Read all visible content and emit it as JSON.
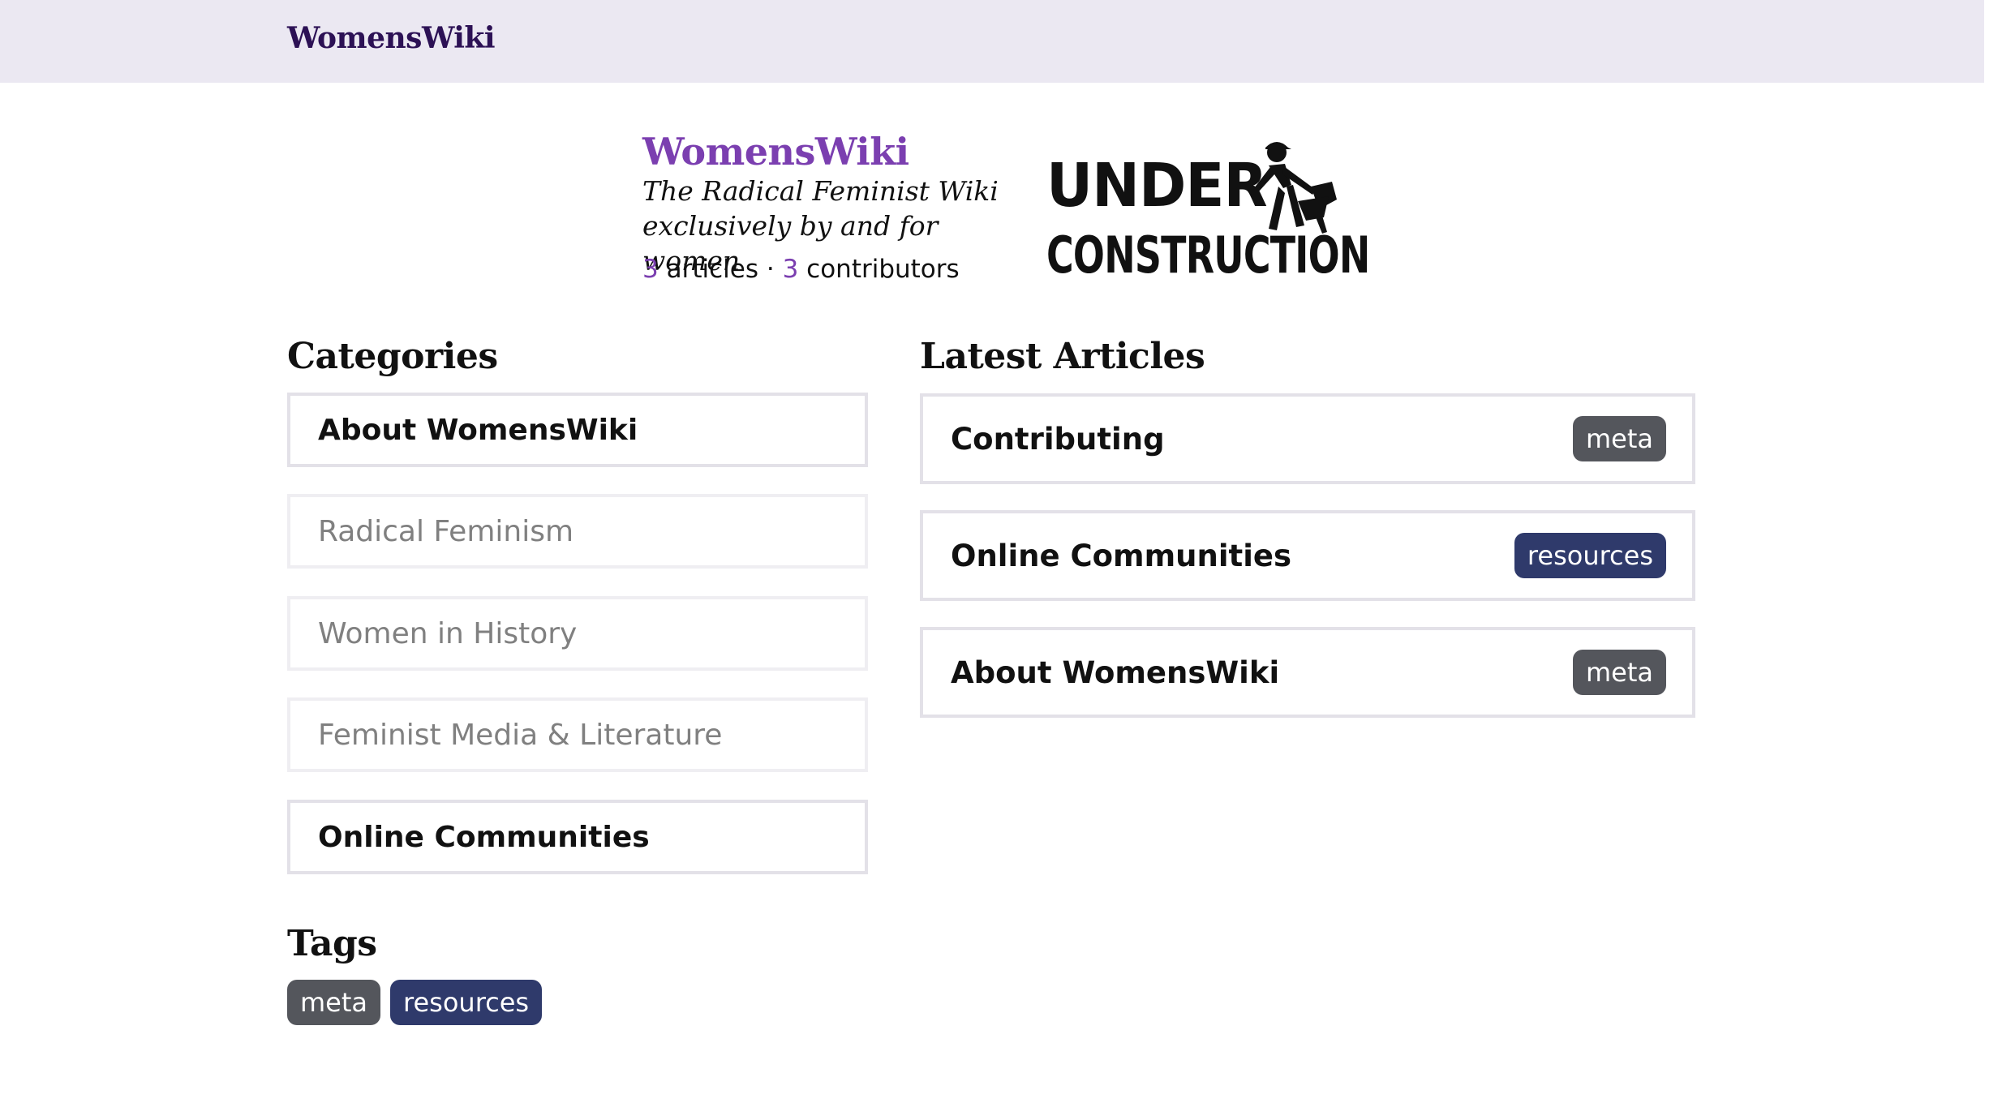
{
  "header": {
    "brand": "WomensWiki"
  },
  "hero": {
    "title": "WomensWiki",
    "tagline_line1": "The Radical Feminist Wiki",
    "tagline_line2": "exclusively by and for women",
    "article_count": "3",
    "articles_label": "articles",
    "separator": "·",
    "contributor_count": "3",
    "contributors_label": "contributors",
    "construction_line1": "UNDER",
    "construction_line2": "CONSTRUCTION",
    "construction_icon": "worker-with-shovel-icon"
  },
  "categories": {
    "heading": "Categories",
    "items": [
      {
        "label": "About WomensWiki",
        "state": "active"
      },
      {
        "label": "Radical Feminism",
        "state": "dim"
      },
      {
        "label": "Women in History",
        "state": "dim"
      },
      {
        "label": "Feminist Media & Literature",
        "state": "dim"
      },
      {
        "label": "Online Communities",
        "state": "active"
      }
    ]
  },
  "latest": {
    "heading": "Latest Articles",
    "items": [
      {
        "title": "Contributing",
        "tag": "meta"
      },
      {
        "title": "Online Communities",
        "tag": "resources"
      },
      {
        "title": "About WomensWiki",
        "tag": "meta"
      }
    ]
  },
  "tags": {
    "heading": "Tags",
    "items": [
      "meta",
      "resources"
    ]
  },
  "colors": {
    "accent": "#7b3fb0",
    "header_bg": "#ebe8f2",
    "brand_dark": "#2c1155",
    "tag_meta": "#54565c",
    "tag_resources": "#2f3a6b"
  }
}
